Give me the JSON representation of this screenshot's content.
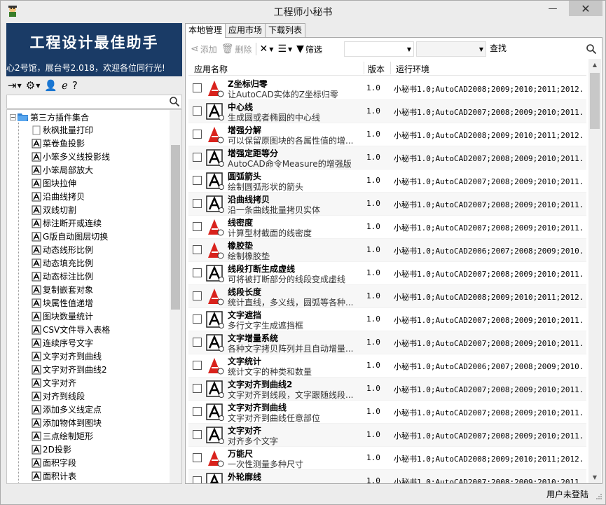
{
  "window": {
    "title": "工程师小秘书",
    "minimize": "—",
    "maximize": "▢",
    "close": "✕"
  },
  "banner": {
    "title": "工程设计最佳助手",
    "marquee": "心2号馆，展台号2.018，欢迎各位同行光!"
  },
  "left_toolbar": {
    "items": [
      {
        "icon": "login-icon",
        "glyph": "⇥",
        "caret": true
      },
      {
        "icon": "settings-icon",
        "glyph": "⚙",
        "caret": true
      },
      {
        "icon": "user-icon",
        "glyph": "👤",
        "caret": false
      },
      {
        "icon": "browser-icon",
        "glyph": "ℯ",
        "caret": false
      },
      {
        "icon": "help-icon",
        "glyph": "?",
        "caret": false
      }
    ]
  },
  "tree": {
    "root_label": "第三方插件集合",
    "items": [
      "秋枫批量打印",
      "菜卷鱼投影",
      "小笨多义线投影线",
      "小笨局部放大",
      "图块拉伸",
      "沿曲线拷贝",
      "双线切割",
      "标注断开或连续",
      "G版自动图层切换",
      "动态线形比例",
      "动态填充比例",
      "动态标注比例",
      "复制嵌套对象",
      "块属性值递增",
      "图块数量统计",
      "CSV文件导入表格",
      "连续序号文字",
      "文字对齐到曲线",
      "文字对齐到曲线2",
      "文字对齐",
      "对齐到线段",
      "添加多义线定点",
      "添加物体到图块",
      "三点绘制矩形",
      "2D投影",
      "面积字段",
      "面积计表",
      "..."
    ]
  },
  "tabs": [
    "本地管理",
    "应用市场",
    "下载列表"
  ],
  "right_toolbar": {
    "add": "添加",
    "delete": "删除",
    "filter": "筛选",
    "find": "查找"
  },
  "table": {
    "columns": [
      "应用名称",
      "版本",
      "运行环境"
    ],
    "rows": [
      {
        "name": "Z坐标归零",
        "desc": "让AutoCAD实体的Z坐标归零",
        "version": "1.0",
        "env": "小秘书1.0;AutoCAD2008;2009;2010;2011;2012...",
        "icon": "red"
      },
      {
        "name": "中心线",
        "desc": "生成圆或者椭圆的中心线",
        "version": "1.0",
        "env": "小秘书1.0;AutoCAD2007;2008;2009;2010;2011...",
        "icon": "bw"
      },
      {
        "name": "增强分解",
        "desc": "可以保留原图块的各属性值的增...",
        "version": "1.0",
        "env": "小秘书1.0;AutoCAD2008;2009;2010;2011;2012...",
        "icon": "red"
      },
      {
        "name": "增强定距等分",
        "desc": "AutoCAD命令Measure的增强版",
        "version": "1.0",
        "env": "小秘书1.0;AutoCAD2007;2008;2009;2010;2011...",
        "icon": "bw"
      },
      {
        "name": "圆弧箭头",
        "desc": "绘制圆弧形状的箭头",
        "version": "1.0",
        "env": "小秘书1.0;AutoCAD2007;2008;2009;2010;2011...",
        "icon": "bw"
      },
      {
        "name": "沿曲线拷贝",
        "desc": "沿一条曲线批量拷贝实体",
        "version": "1.0",
        "env": "小秘书1.0;AutoCAD2007;2008;2009;2010;2011...",
        "icon": "bw"
      },
      {
        "name": "线密度",
        "desc": "计算型材截面的线密度",
        "version": "1.0",
        "env": "小秘书1.0;AutoCAD2007;2008;2009;2010;2011...",
        "icon": "red"
      },
      {
        "name": "橡胶垫",
        "desc": "绘制橡胶垫",
        "version": "1.0",
        "env": "小秘书1.0;AutoCAD2006;2007;2008;2009;2010...",
        "icon": "red"
      },
      {
        "name": "线段打断生成虚线",
        "desc": "可将被打断部分的线段变成虚线",
        "version": "1.0",
        "env": "小秘书1.0;AutoCAD2007;2008;2009;2010;2011...",
        "icon": "bw"
      },
      {
        "name": "线段长度",
        "desc": "统计直线，多义线，圆弧等各种...",
        "version": "1.0",
        "env": "小秘书1.0;AutoCAD2008;2009;2010;2011;2012...",
        "icon": "red"
      },
      {
        "name": "文字遮挡",
        "desc": "多行文字生成遮挡框",
        "version": "1.0",
        "env": "小秘书1.0;AutoCAD2007;2008;2009;2010;2011...",
        "icon": "bw"
      },
      {
        "name": "文字增量系统",
        "desc": "各种文字拷贝阵列并且自动增量...",
        "version": "1.0",
        "env": "小秘书1.0;AutoCAD2007;2008;2009;2010;2011...",
        "icon": "bw"
      },
      {
        "name": "文字统计",
        "desc": "统计文字的种类和数量",
        "version": "1.0",
        "env": "小秘书1.0;AutoCAD2006;2007;2008;2009;2010...",
        "icon": "red"
      },
      {
        "name": "文字对齐到曲线2",
        "desc": "文字对齐到线段，文字跟随线段...",
        "version": "1.0",
        "env": "小秘书1.0;AutoCAD2007;2008;2009;2010;2011...",
        "icon": "bw"
      },
      {
        "name": "文字对齐到曲线",
        "desc": "文字对齐到曲线任意部位",
        "version": "1.0",
        "env": "小秘书1.0;AutoCAD2007;2008;2009;2010;2011...",
        "icon": "bw"
      },
      {
        "name": "文字对齐",
        "desc": "对齐多个文字",
        "version": "1.0",
        "env": "小秘书1.0;AutoCAD2007;2008;2009;2010;2011...",
        "icon": "bw"
      },
      {
        "name": "万能尺",
        "desc": "一次性测量多种尺寸",
        "version": "1.0",
        "env": "小秘书1.0;AutoCAD2008;2009;2010;2011;2012...",
        "icon": "red"
      },
      {
        "name": "外轮廓线",
        "desc": "",
        "version": "1.0",
        "env": "小秘书1.0;AutoCAD2007;2008;2009;2010;2011...",
        "icon": "bw"
      }
    ]
  },
  "status": {
    "login": "用户未登陆"
  },
  "colors": {
    "banner_bg": "#1a3b66",
    "icon_red": "#d9221c"
  }
}
